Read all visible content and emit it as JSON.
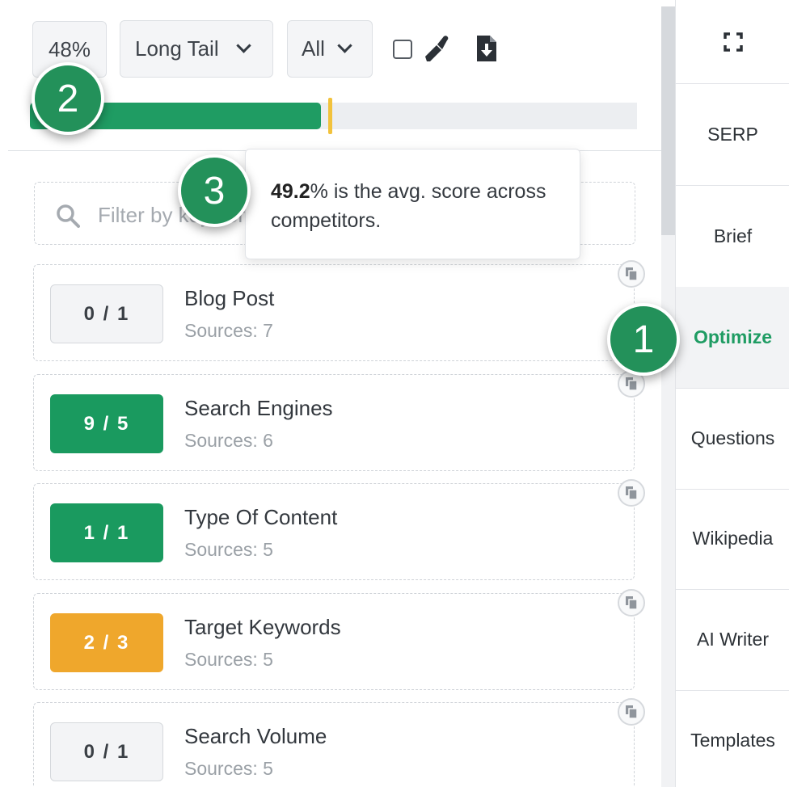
{
  "toolbar": {
    "score": "48%",
    "mode_select": "Long Tail",
    "filter_select": "All"
  },
  "progress": {
    "current_percent": 48,
    "avg_competitor_percent": 49.2
  },
  "badges": [
    "1",
    "2",
    "3"
  ],
  "search": {
    "placeholder": "Filter by keyword"
  },
  "tooltip": {
    "value": "49.2",
    "text": "% is the avg. score across competitors."
  },
  "cards": [
    {
      "score": "0 / 1",
      "title": "Blog Post",
      "sources": "Sources: 7",
      "status": "neutral"
    },
    {
      "score": "9 / 5",
      "title": "Search Engines",
      "sources": "Sources: 6",
      "status": "good"
    },
    {
      "score": "1 / 1",
      "title": "Type Of Content",
      "sources": "Sources: 5",
      "status": "good"
    },
    {
      "score": "2 / 3",
      "title": "Target Keywords",
      "sources": "Sources: 5",
      "status": "warn"
    },
    {
      "score": "0 / 1",
      "title": "Search Volume",
      "sources": "Sources: 5",
      "status": "neutral"
    }
  ],
  "sidebar": {
    "tabs": [
      {
        "label": "SERP",
        "active": false
      },
      {
        "label": "Brief",
        "active": false
      },
      {
        "label": "Optimize",
        "active": true
      },
      {
        "label": "Questions",
        "active": false
      },
      {
        "label": "Wikipedia",
        "active": false
      },
      {
        "label": "AI Writer",
        "active": false
      },
      {
        "label": "Templates",
        "active": false
      }
    ]
  },
  "colors": {
    "accent_green": "#1f9c63",
    "warning_orange": "#efa72c",
    "avg_marker_yellow": "#f2c23c"
  },
  "icons": [
    "marker-icon",
    "download-icon",
    "search-icon",
    "copy-icon",
    "expand-icon"
  ]
}
